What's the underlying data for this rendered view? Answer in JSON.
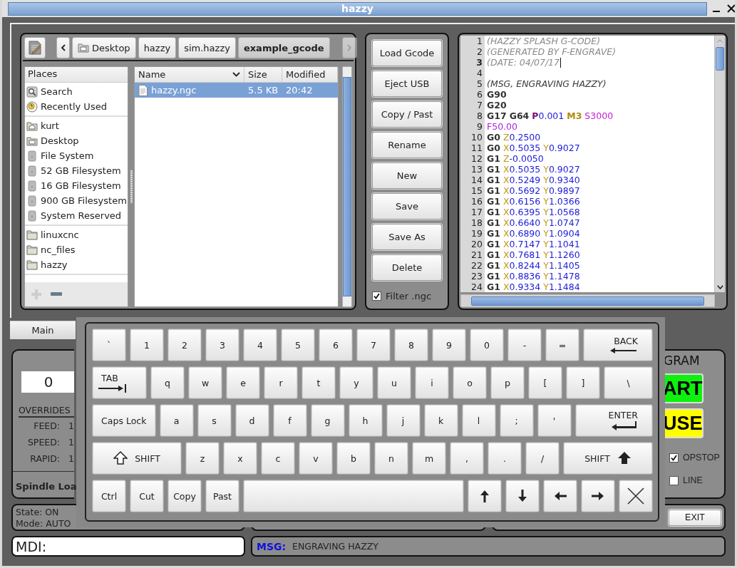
{
  "window": {
    "title": "hazzy"
  },
  "file_chooser": {
    "path": [
      {
        "label": "Desktop",
        "kind": "desktop",
        "selected": false
      },
      {
        "label": "hazzy",
        "kind": "plain",
        "selected": false
      },
      {
        "label": "sim.hazzy",
        "kind": "plain",
        "selected": false
      },
      {
        "label": "example_gcode",
        "kind": "plain",
        "selected": true
      }
    ],
    "places": {
      "title": "Places",
      "groups": [
        [
          {
            "label": "Search",
            "kind": "search"
          },
          {
            "label": "Recently Used",
            "kind": "recent"
          }
        ],
        [
          {
            "label": "kurt",
            "kind": "home"
          },
          {
            "label": "Desktop",
            "kind": "desktop"
          },
          {
            "label": "File System",
            "kind": "drive"
          },
          {
            "label": "52 GB Filesystem",
            "kind": "drive"
          },
          {
            "label": "16 GB Filesystem",
            "kind": "drive"
          },
          {
            "label": "900 GB Filesystem",
            "kind": "drive"
          },
          {
            "label": "System Reserved",
            "kind": "drive"
          }
        ],
        [
          {
            "label": "linuxcnc",
            "kind": "folder"
          },
          {
            "label": "nc_files",
            "kind": "folder"
          },
          {
            "label": "hazzy",
            "kind": "folder"
          }
        ]
      ]
    },
    "columns": [
      {
        "label": "Name",
        "sorted": true
      },
      {
        "label": "Size",
        "sorted": false
      },
      {
        "label": "Modified",
        "sorted": false
      }
    ],
    "files": [
      {
        "name": "hazzy.ngc",
        "size": "5.5 KB",
        "modified": "20:42",
        "selected": true
      }
    ]
  },
  "file_buttons": [
    "Load Gcode",
    "Eject USB",
    "Copy / Past",
    "Rename",
    "New",
    "Save",
    "Save As",
    "Delete"
  ],
  "filter": {
    "label": "Filter .ngc",
    "checked": true
  },
  "editor": {
    "lines": [
      {
        "number": "1",
        "current": false,
        "words": [
          [
            {
              "text": "(HAZZY SPLASH G-CODE)",
              "kind": "comment"
            }
          ]
        ]
      },
      {
        "number": "2",
        "current": false,
        "words": [
          [
            {
              "text": "(GENERATED BY F-ENGRAVE)",
              "kind": "comment"
            }
          ]
        ]
      },
      {
        "number": "3",
        "current": true,
        "words": [
          [
            {
              "text": "(DATE: 04/07/17",
              "kind": "comment"
            }
          ]
        ]
      },
      {
        "number": "4",
        "current": false
      },
      {
        "number": "5",
        "current": false,
        "words": [
          [
            {
              "text": "(MSG, ENGRAVING HAZZY)",
              "kind": "message"
            }
          ]
        ]
      },
      {
        "number": "6",
        "current": false,
        "words": [
          [
            {
              "text": "G90",
              "kind": "gcode"
            }
          ]
        ]
      },
      {
        "number": "7",
        "current": false,
        "words": [
          [
            {
              "text": "G20",
              "kind": "gcode"
            }
          ]
        ]
      },
      {
        "number": "8",
        "current": false,
        "words": [
          [
            {
              "text": "G17",
              "kind": "gcode"
            }
          ],
          [
            {
              "text": "G64",
              "kind": "gcode"
            }
          ],
          [
            {
              "text": "P",
              "kind": "param"
            },
            {
              "text": "0.001",
              "kind": "value"
            }
          ],
          [
            {
              "text": "M3",
              "kind": "mcode"
            }
          ],
          [
            {
              "text": "S3000",
              "kind": "spindle"
            }
          ]
        ]
      },
      {
        "number": "9",
        "current": false,
        "words": [
          [
            {
              "text": "F50.00",
              "kind": "feed"
            }
          ]
        ]
      },
      {
        "number": "10",
        "current": false,
        "words": [
          [
            {
              "text": "G0",
              "kind": "gcode"
            }
          ],
          [
            {
              "text": "Z",
              "kind": "axis"
            },
            {
              "text": "0.2500",
              "kind": "value"
            }
          ]
        ]
      },
      {
        "number": "11",
        "current": false,
        "words": [
          [
            {
              "text": "G0",
              "kind": "gcode"
            }
          ],
          [
            {
              "text": "X",
              "kind": "axis"
            },
            {
              "text": "0.5035",
              "kind": "value"
            }
          ],
          [
            {
              "text": "Y",
              "kind": "axis"
            },
            {
              "text": "0.9027",
              "kind": "value"
            }
          ]
        ]
      },
      {
        "number": "12",
        "current": false,
        "words": [
          [
            {
              "text": "G1",
              "kind": "gcode"
            }
          ],
          [
            {
              "text": "Z",
              "kind": "axis"
            },
            {
              "text": "-0.0050",
              "kind": "value"
            }
          ]
        ]
      },
      {
        "number": "13",
        "current": false,
        "words": [
          [
            {
              "text": "G1",
              "kind": "gcode"
            }
          ],
          [
            {
              "text": "X",
              "kind": "axis"
            },
            {
              "text": "0.5035",
              "kind": "value"
            }
          ],
          [
            {
              "text": "Y",
              "kind": "axis"
            },
            {
              "text": "0.9027",
              "kind": "value"
            }
          ]
        ]
      },
      {
        "number": "14",
        "current": false,
        "words": [
          [
            {
              "text": "G1",
              "kind": "gcode"
            }
          ],
          [
            {
              "text": "X",
              "kind": "axis"
            },
            {
              "text": "0.5249",
              "kind": "value"
            }
          ],
          [
            {
              "text": "Y",
              "kind": "axis"
            },
            {
              "text": "0.9340",
              "kind": "value"
            }
          ]
        ]
      },
      {
        "number": "15",
        "current": false,
        "words": [
          [
            {
              "text": "G1",
              "kind": "gcode"
            }
          ],
          [
            {
              "text": "X",
              "kind": "axis"
            },
            {
              "text": "0.5692",
              "kind": "value"
            }
          ],
          [
            {
              "text": "Y",
              "kind": "axis"
            },
            {
              "text": "0.9897",
              "kind": "value"
            }
          ]
        ]
      },
      {
        "number": "16",
        "current": false,
        "words": [
          [
            {
              "text": "G1",
              "kind": "gcode"
            }
          ],
          [
            {
              "text": "X",
              "kind": "axis"
            },
            {
              "text": "0.6156",
              "kind": "value"
            }
          ],
          [
            {
              "text": "Y",
              "kind": "axis"
            },
            {
              "text": "1.0366",
              "kind": "value"
            }
          ]
        ]
      },
      {
        "number": "17",
        "current": false,
        "words": [
          [
            {
              "text": "G1",
              "kind": "gcode"
            }
          ],
          [
            {
              "text": "X",
              "kind": "axis"
            },
            {
              "text": "0.6395",
              "kind": "value"
            }
          ],
          [
            {
              "text": "Y",
              "kind": "axis"
            },
            {
              "text": "1.0568",
              "kind": "value"
            }
          ]
        ]
      },
      {
        "number": "18",
        "current": false,
        "words": [
          [
            {
              "text": "G1",
              "kind": "gcode"
            }
          ],
          [
            {
              "text": "X",
              "kind": "axis"
            },
            {
              "text": "0.6640",
              "kind": "value"
            }
          ],
          [
            {
              "text": "Y",
              "kind": "axis"
            },
            {
              "text": "1.0747",
              "kind": "value"
            }
          ]
        ]
      },
      {
        "number": "19",
        "current": false,
        "words": [
          [
            {
              "text": "G1",
              "kind": "gcode"
            }
          ],
          [
            {
              "text": "X",
              "kind": "axis"
            },
            {
              "text": "0.6890",
              "kind": "value"
            }
          ],
          [
            {
              "text": "Y",
              "kind": "axis"
            },
            {
              "text": "1.0904",
              "kind": "value"
            }
          ]
        ]
      },
      {
        "number": "20",
        "current": false,
        "words": [
          [
            {
              "text": "G1",
              "kind": "gcode"
            }
          ],
          [
            {
              "text": "X",
              "kind": "axis"
            },
            {
              "text": "0.7147",
              "kind": "value"
            }
          ],
          [
            {
              "text": "Y",
              "kind": "axis"
            },
            {
              "text": "1.1041",
              "kind": "value"
            }
          ]
        ]
      },
      {
        "number": "21",
        "current": false,
        "words": [
          [
            {
              "text": "G1",
              "kind": "gcode"
            }
          ],
          [
            {
              "text": "X",
              "kind": "axis"
            },
            {
              "text": "0.7681",
              "kind": "value"
            }
          ],
          [
            {
              "text": "Y",
              "kind": "axis"
            },
            {
              "text": "1.1260",
              "kind": "value"
            }
          ]
        ]
      },
      {
        "number": "22",
        "current": false,
        "words": [
          [
            {
              "text": "G1",
              "kind": "gcode"
            }
          ],
          [
            {
              "text": "X",
              "kind": "axis"
            },
            {
              "text": "0.8244",
              "kind": "value"
            }
          ],
          [
            {
              "text": "Y",
              "kind": "axis"
            },
            {
              "text": "1.1405",
              "kind": "value"
            }
          ]
        ]
      },
      {
        "number": "23",
        "current": false,
        "words": [
          [
            {
              "text": "G1",
              "kind": "gcode"
            }
          ],
          [
            {
              "text": "X",
              "kind": "axis"
            },
            {
              "text": "0.8836",
              "kind": "value"
            }
          ],
          [
            {
              "text": "Y",
              "kind": "axis"
            },
            {
              "text": "1.1478",
              "kind": "value"
            }
          ]
        ]
      },
      {
        "number": "24",
        "current": false,
        "words": [
          [
            {
              "text": "G1",
              "kind": "gcode"
            }
          ],
          [
            {
              "text": "X",
              "kind": "axis"
            },
            {
              "text": "0.9334",
              "kind": "value"
            }
          ],
          [
            {
              "text": "Y",
              "kind": "axis"
            },
            {
              "text": "1.1484",
              "kind": "value"
            }
          ]
        ]
      }
    ]
  },
  "tabs": [
    {
      "label": "Main",
      "selected": true
    }
  ],
  "status_panel": {
    "value": "0",
    "overrides_title": "OVERRIDES",
    "overrides": [
      {
        "label": "FEED:",
        "value": "1"
      },
      {
        "label": "SPEED:",
        "value": "1"
      },
      {
        "label": "RAPID:",
        "value": "1"
      }
    ],
    "spindle_load": "Spindle Loa"
  },
  "program": {
    "title": "GRAM",
    "buttons": [
      {
        "label": "ART",
        "kind": "start"
      },
      {
        "label": "USE",
        "kind": "pause"
      }
    ],
    "options": [
      {
        "label": "OPSTOP",
        "checked": true
      },
      {
        "label": "LINE",
        "checked": false
      }
    ]
  },
  "machine_state": [
    "State: ON",
    "Mode: AUTO"
  ],
  "exit_button": "EXIT",
  "mdi": {
    "value": "MDI:"
  },
  "message": {
    "label": "MSG:",
    "text": "ENGRAVING HAZZY"
  },
  "keyboard": {
    "rows": [
      {
        "keys": [
          {
            "label": "`",
            "kind": "char"
          },
          {
            "label": "1",
            "kind": "char"
          },
          {
            "label": "2",
            "kind": "char"
          },
          {
            "label": "3",
            "kind": "char"
          },
          {
            "label": "4",
            "kind": "char"
          },
          {
            "label": "5",
            "kind": "char"
          },
          {
            "label": "6",
            "kind": "char"
          },
          {
            "label": "7",
            "kind": "char"
          },
          {
            "label": "8",
            "kind": "char"
          },
          {
            "label": "9",
            "kind": "char"
          },
          {
            "label": "0",
            "kind": "char"
          },
          {
            "label": "-",
            "kind": "char"
          },
          {
            "label": "=",
            "kind": "char"
          },
          {
            "label": "BACK",
            "kind": "back"
          }
        ]
      },
      {
        "keys": [
          {
            "label": "TAB",
            "kind": "tab"
          },
          {
            "label": "q",
            "kind": "char"
          },
          {
            "label": "w",
            "kind": "char"
          },
          {
            "label": "e",
            "kind": "char"
          },
          {
            "label": "r",
            "kind": "char"
          },
          {
            "label": "t",
            "kind": "char"
          },
          {
            "label": "y",
            "kind": "char"
          },
          {
            "label": "u",
            "kind": "char"
          },
          {
            "label": "i",
            "kind": "char"
          },
          {
            "label": "o",
            "kind": "char"
          },
          {
            "label": "p",
            "kind": "char"
          },
          {
            "label": "[",
            "kind": "char"
          },
          {
            "label": "]",
            "kind": "char"
          },
          {
            "label": "\\",
            "kind": "wide"
          }
        ]
      },
      {
        "keys": [
          {
            "label": "Caps Lock",
            "kind": "wide"
          },
          {
            "label": "a",
            "kind": "char"
          },
          {
            "label": "s",
            "kind": "char"
          },
          {
            "label": "d",
            "kind": "char"
          },
          {
            "label": "f",
            "kind": "char"
          },
          {
            "label": "g",
            "kind": "char"
          },
          {
            "label": "h",
            "kind": "char"
          },
          {
            "label": "j",
            "kind": "char"
          },
          {
            "label": "k",
            "kind": "char"
          },
          {
            "label": "l",
            "kind": "char"
          },
          {
            "label": ";",
            "kind": "char"
          },
          {
            "label": "'",
            "kind": "char"
          },
          {
            "label": "ENTER",
            "kind": "enter"
          }
        ]
      },
      {
        "keys": [
          {
            "label": "SHIFT",
            "kind": "shift_left"
          },
          {
            "label": "z",
            "kind": "char"
          },
          {
            "label": "x",
            "kind": "char"
          },
          {
            "label": "c",
            "kind": "char"
          },
          {
            "label": "v",
            "kind": "char"
          },
          {
            "label": "b",
            "kind": "char"
          },
          {
            "label": "n",
            "kind": "char"
          },
          {
            "label": "m",
            "kind": "char"
          },
          {
            "label": ",",
            "kind": "char"
          },
          {
            "label": ".",
            "kind": "char"
          },
          {
            "label": "/",
            "kind": "char"
          },
          {
            "label": "SHIFT",
            "kind": "shift_right"
          }
        ]
      },
      {
        "keys": [
          {
            "label": "Ctrl",
            "kind": "char"
          },
          {
            "label": "Cut",
            "kind": "char"
          },
          {
            "label": "Copy",
            "kind": "char"
          },
          {
            "label": "Past",
            "kind": "char"
          },
          {
            "kind": "space"
          },
          {
            "kind": "up"
          },
          {
            "kind": "down"
          },
          {
            "kind": "left"
          },
          {
            "kind": "right"
          },
          {
            "kind": "close"
          }
        ]
      }
    ]
  }
}
